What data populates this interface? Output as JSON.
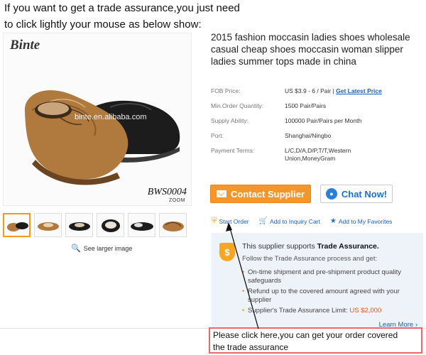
{
  "intro": {
    "line1": "If you want to get a trade assurance,you just need",
    "line2": "to click lightly your mouse as below show:"
  },
  "gallery": {
    "brand": "Binte",
    "watermark": "binte.en.alibaba.com",
    "model": "BWS0004",
    "zoom": "ZOOM",
    "see_larger": "See larger image",
    "thumbnails_count": 6
  },
  "product": {
    "title": "2015 fashion moccasin ladies shoes wholesale casual cheap shoes moccasin woman slipper ladies summer tops made in china",
    "specs": [
      {
        "label": "FOB Price:",
        "value": "US $3.9 - 6 / Pair |",
        "link": "Get Latest Price"
      },
      {
        "label": "Min.Order Quantity:",
        "value": "1500 Pair/Pairs"
      },
      {
        "label": "Supply Ability:",
        "value": "100000 Pair/Pairs per Month"
      },
      {
        "label": "Port:",
        "value": "Shanghai/Ningbo"
      },
      {
        "label": "Payment Terms:",
        "value": "L/C,D/A,D/P,T/T,Western Union,MoneyGram"
      }
    ]
  },
  "buttons": {
    "contact": "Contact Supplier",
    "chat": "Chat Now!"
  },
  "actions": {
    "start_order": "Start Order",
    "inquiry_cart": "Add to Inquiry Cart",
    "favorites": "Add to My Favorites"
  },
  "trade_assurance": {
    "shield_letter": "$",
    "head_prefix": "This supplier supports",
    "head_bold": "Trade Assurance.",
    "sub": "Follow the Trade Assurance process and get:",
    "items": [
      "On-time shipment and pre-shipment product quality safeguards",
      "Refund up to the covered amount agreed with your supplier"
    ],
    "limit_label": "Supplier's Trade Assurance Limit:",
    "limit_value": "US $2,000",
    "learn_more": "Learn More ›"
  },
  "note": {
    "line1": "Please click here,you can get your order covered",
    "line2": "the trade assurance"
  },
  "colors": {
    "orange": "#f5962a",
    "link_blue": "#1e5db5",
    "note_border": "#e8686e",
    "panel_bg": "#eef3fa"
  }
}
